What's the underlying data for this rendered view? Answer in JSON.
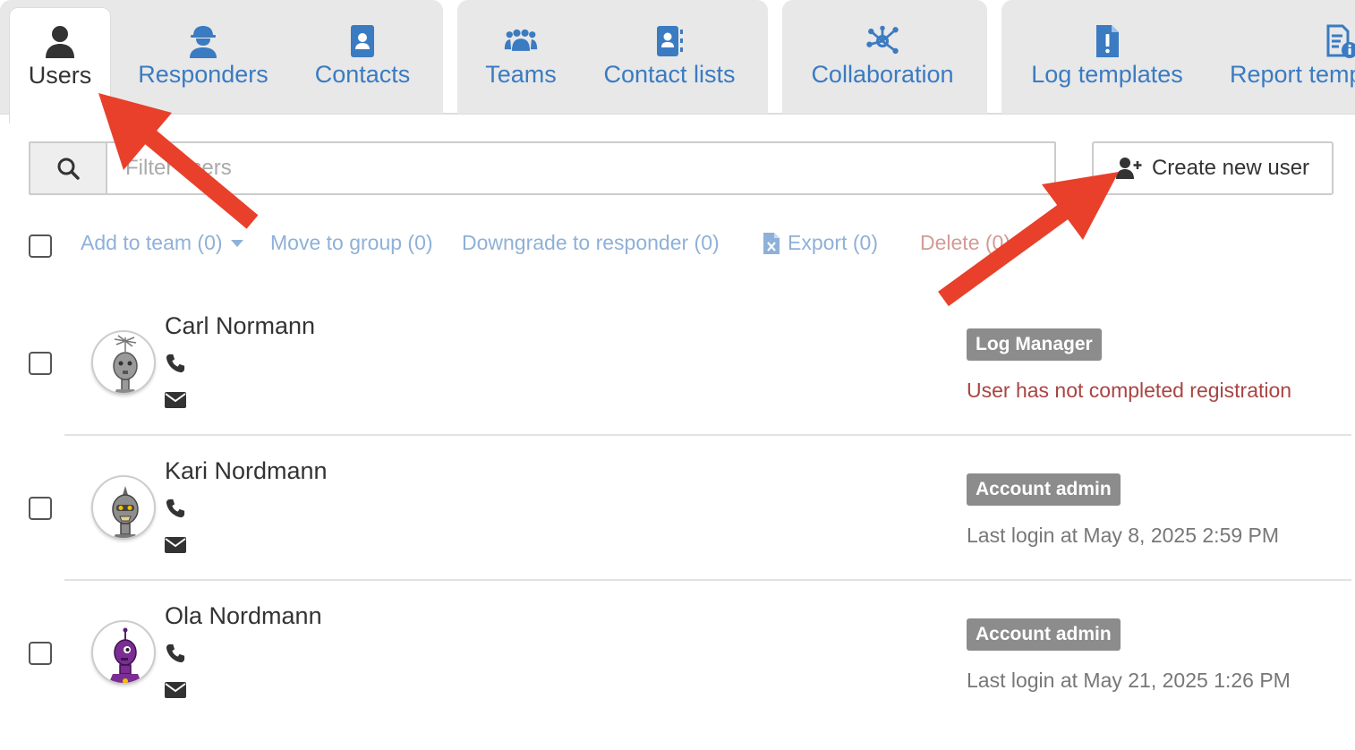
{
  "tabs": [
    {
      "label": "Users",
      "icon": "user-icon",
      "active": true
    },
    {
      "label": "Responders",
      "icon": "hardhat-worker-icon",
      "active": false
    },
    {
      "label": "Contacts",
      "icon": "contact-card-icon",
      "active": false
    },
    {
      "label": "Teams",
      "icon": "team-people-icon",
      "active": false
    },
    {
      "label": "Contact lists",
      "icon": "address-book-icon",
      "active": false
    },
    {
      "label": "Collaboration",
      "icon": "network-hub-icon",
      "active": false
    },
    {
      "label": "Log templates",
      "icon": "file-exclamation-icon",
      "active": false
    },
    {
      "label": "Report temp",
      "icon": "file-info-icon",
      "active": false
    }
  ],
  "filter": {
    "placeholder": "Filter users",
    "value": ""
  },
  "create_button": {
    "label": "Create new user",
    "icon": "user-plus-icon"
  },
  "actions": {
    "add_to_team": "Add to team (0)",
    "move_to_group": "Move to group (0)",
    "downgrade": "Downgrade to responder (0)",
    "export": "Export (0)",
    "delete": "Delete (0)"
  },
  "users": [
    {
      "name": "Carl Normann",
      "role": "Log Manager",
      "status": "User has not completed registration",
      "status_type": "warning"
    },
    {
      "name": "Kari Nordmann",
      "role": "Account admin",
      "status": "Last login at May 8, 2025 2:59 PM",
      "status_type": "info"
    },
    {
      "name": "Ola Nordmann",
      "role": "Account admin",
      "status": "Last login at May 21, 2025 1:26 PM",
      "status_type": "info"
    }
  ],
  "colors": {
    "link_blue": "#3a7bc2",
    "badge_gray": "#8c8c8c",
    "warning_red": "#a94442",
    "arrow_red": "#e8402a"
  }
}
